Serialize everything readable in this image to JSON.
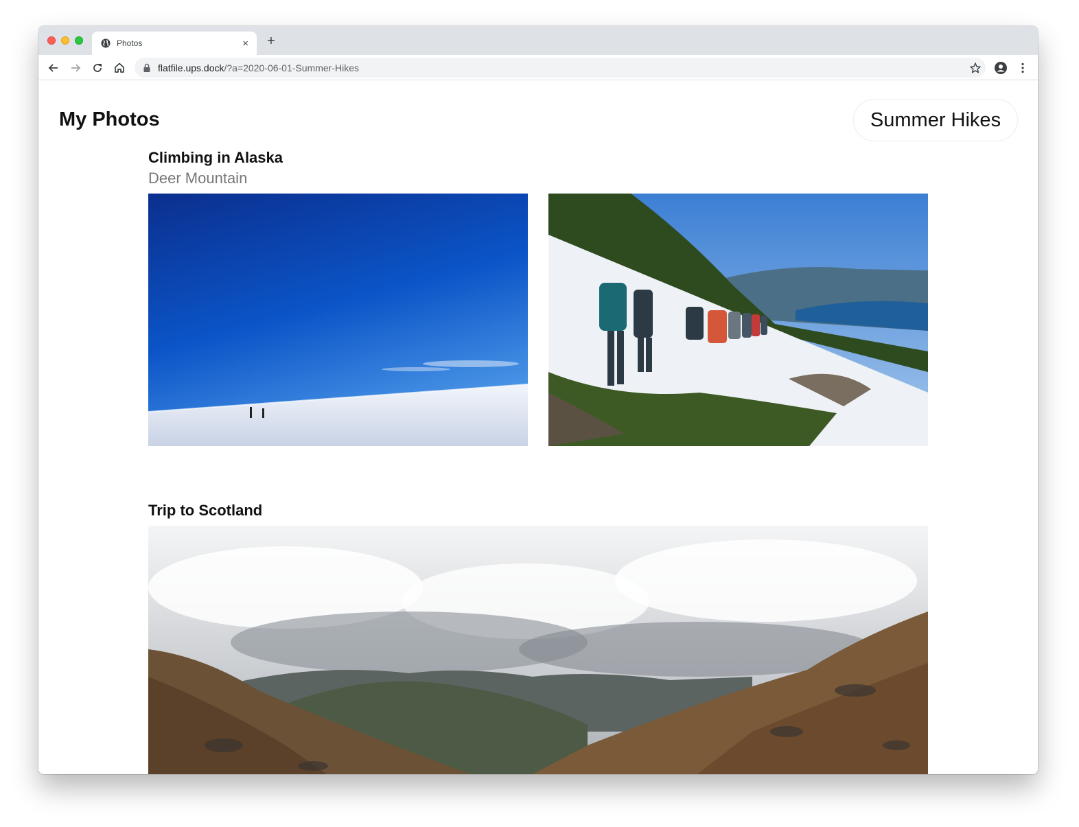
{
  "browser": {
    "tab_title": "Photos",
    "tab_close": "×",
    "new_tab": "+",
    "url_host": "flatfile.ups.dock",
    "url_path": "/?a=2020-06-01-Summer-Hikes"
  },
  "page": {
    "site_title": "My Photos",
    "album_name": "Summer Hikes",
    "sections": [
      {
        "title": "Climbing in Alaska",
        "subtitle": "Deer Mountain",
        "photos": [
          "snowfield-climbers-photo",
          "hikers-snow-slope-photo"
        ]
      },
      {
        "title": "Trip to Scotland",
        "photos": [
          "scottish-valley-photo"
        ]
      }
    ]
  },
  "colors": {
    "tabstrip": "#dee1e6",
    "omnibox": "#f1f3f4",
    "subtitle": "#777777"
  }
}
